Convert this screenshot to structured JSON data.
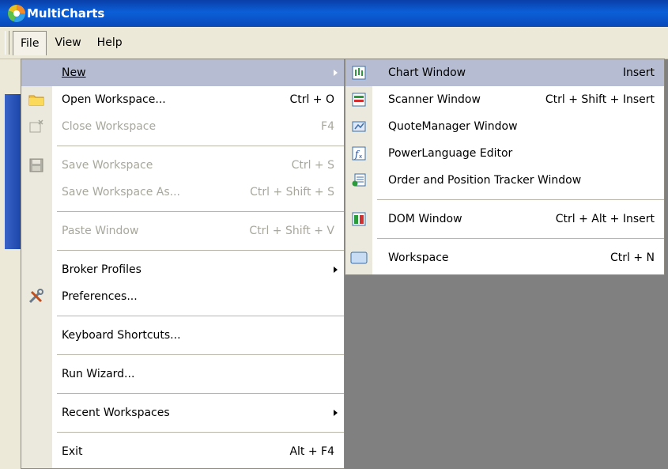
{
  "window": {
    "title": "MultiCharts"
  },
  "menubar": {
    "items": [
      "File",
      "View",
      "Help"
    ]
  },
  "file_menu": {
    "items": [
      {
        "label": "New",
        "shortcut": "",
        "icon": "none",
        "submenu": true,
        "highlighted": true,
        "disabled": false
      },
      {
        "label": "Open Workspace...",
        "shortcut": "Ctrl + O",
        "icon": "folder-icon",
        "disabled": false
      },
      {
        "label": "Close Workspace",
        "shortcut": "F4",
        "icon": "close-workspace-icon",
        "disabled": true
      },
      {
        "label": "Save Workspace",
        "shortcut": "Ctrl + S",
        "icon": "floppy-disk-icon",
        "disabled": true
      },
      {
        "label": "Save Workspace As...",
        "shortcut": "Ctrl + Shift + S",
        "icon": "none",
        "disabled": true
      },
      {
        "label": "Paste Window",
        "shortcut": "Ctrl + Shift + V",
        "icon": "none",
        "disabled": true
      },
      {
        "label": "Broker Profiles",
        "shortcut": "",
        "icon": "none",
        "submenu": true,
        "disabled": false
      },
      {
        "label": "Preferences...",
        "shortcut": "",
        "icon": "tools-icon",
        "disabled": false
      },
      {
        "label": "Keyboard Shortcuts...",
        "shortcut": "",
        "icon": "none",
        "disabled": false
      },
      {
        "label": "Run Wizard...",
        "shortcut": "",
        "icon": "none",
        "disabled": false
      },
      {
        "label": "Recent Workspaces",
        "shortcut": "",
        "icon": "none",
        "submenu": true,
        "disabled": false
      },
      {
        "label": "Exit",
        "shortcut": "Alt + F4",
        "icon": "none",
        "disabled": false
      }
    ]
  },
  "new_submenu": {
    "items": [
      {
        "label": "Chart Window",
        "shortcut": "Insert",
        "icon": "chart-window-icon",
        "highlighted": true
      },
      {
        "label": "Scanner Window",
        "shortcut": "Ctrl + Shift + Insert",
        "icon": "scanner-window-icon"
      },
      {
        "label": "QuoteManager Window",
        "shortcut": "",
        "icon": "quotemanager-icon"
      },
      {
        "label": "PowerLanguage Editor",
        "shortcut": "",
        "icon": "powerlanguage-editor-icon"
      },
      {
        "label": "Order and Position Tracker Window",
        "shortcut": "",
        "icon": "order-tracker-icon"
      },
      {
        "label": "DOM Window",
        "shortcut": "Ctrl + Alt + Insert",
        "icon": "dom-window-icon"
      },
      {
        "label": "Workspace",
        "shortcut": "Ctrl + N",
        "icon": "workspace-icon"
      }
    ]
  },
  "colors": {
    "titlebar": "#0b5fd8",
    "menu_highlight": "#b6bdd2",
    "disabled_text": "#a8a79c",
    "gutter": "#ebe9dd"
  }
}
